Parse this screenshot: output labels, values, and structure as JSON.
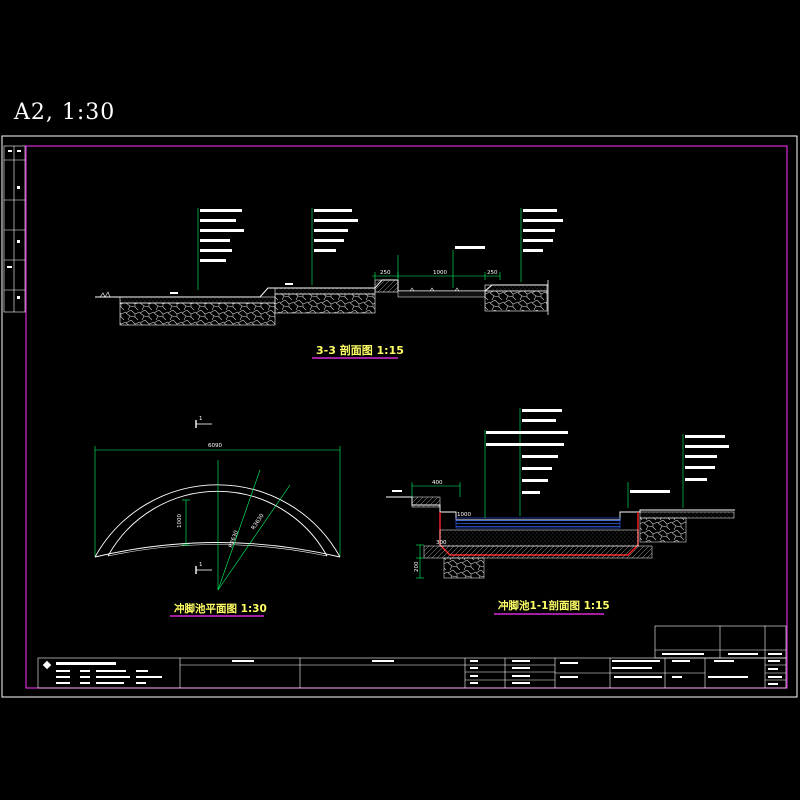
{
  "sheet": {
    "label": "A2, 1:30"
  },
  "views": {
    "section_33": {
      "title": "3-3 剖面图  1:15",
      "dims": [
        "250",
        "1000",
        "250"
      ]
    },
    "pool_plan": {
      "title": "冲脚池平面图  1:30",
      "dims": [
        "6090",
        "1000",
        "R2630",
        "R3630"
      ],
      "cut_mark": "1"
    },
    "pool_section_11": {
      "title": "冲脚池1-1剖面图  1:15",
      "dims": [
        "400",
        "300",
        "1000",
        "200"
      ]
    }
  },
  "colors": {
    "background": "#000000",
    "frame": "#ffffff",
    "inner_frame": "#ff33ff",
    "title_text": "#ffff66",
    "dimension": "#00ff66",
    "hatch": "#cccccc",
    "water": "#3366ff",
    "waterproof": "#ff2222"
  }
}
